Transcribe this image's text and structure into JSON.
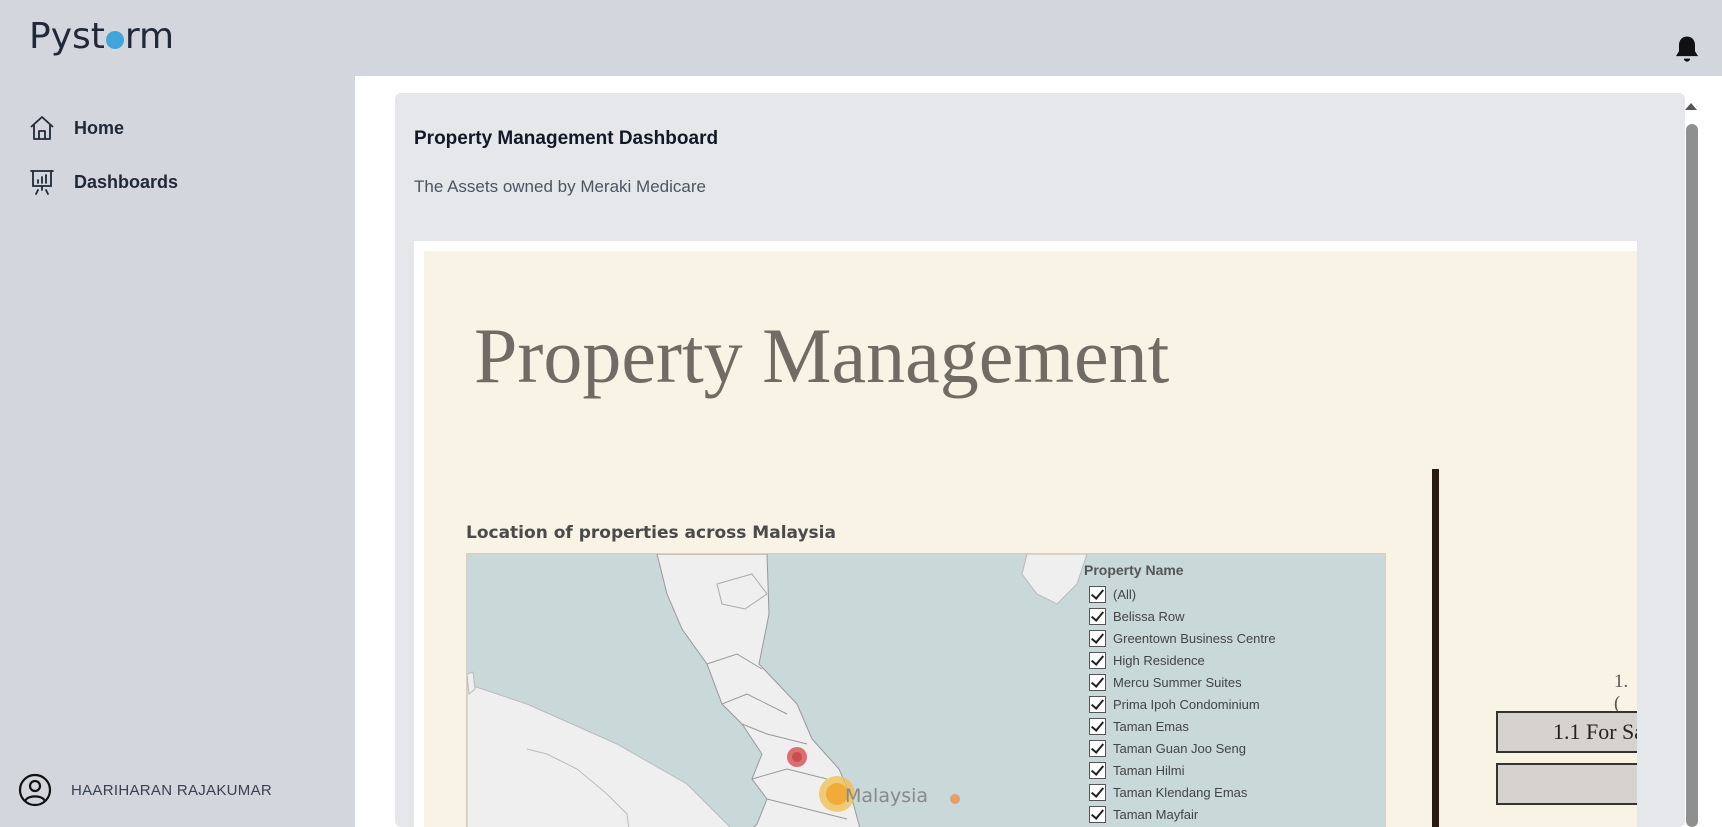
{
  "app": {
    "logo_prefix": "Pyst",
    "logo_suffix": "rm"
  },
  "sidebar": {
    "items": [
      {
        "label": "Home",
        "icon": "home-icon"
      },
      {
        "label": "Dashboards",
        "icon": "presentation-chart-icon"
      }
    ],
    "user": {
      "name": "HAARIHARAN RAJAKUMAR",
      "icon": "user-circle-icon"
    }
  },
  "header": {
    "notification_icon": "bell-icon"
  },
  "card": {
    "title": "Property Management Dashboard",
    "subtitle": "The Assets owned by Meraki Medicare"
  },
  "viz": {
    "title": "Property Management",
    "map_title": "Location of properties across Malaysia",
    "map_country_label": "Malaysia",
    "legend_title": "Property Name",
    "legend_items": [
      "(All)",
      "Belissa Row",
      "Greentown Business Centre",
      "High Residence",
      "Mercu Summer Suites",
      "Prima Ipoh Condominium",
      "Taman Emas",
      "Taman Guan Joo Seng",
      "Taman Hilmi",
      "Taman Klendang Emas",
      "Taman Mayfair"
    ],
    "right_label": "1. (",
    "right_button_1": "1.1 For Sa",
    "right_button_2": ""
  },
  "colors": {
    "sidebar_bg": "#d3d6dd",
    "card_bg": "#e5e7eb",
    "viz_bg": "#f9f3e6",
    "map_water": "#c9d8d9",
    "logo_dot": "#3fa6d9"
  }
}
